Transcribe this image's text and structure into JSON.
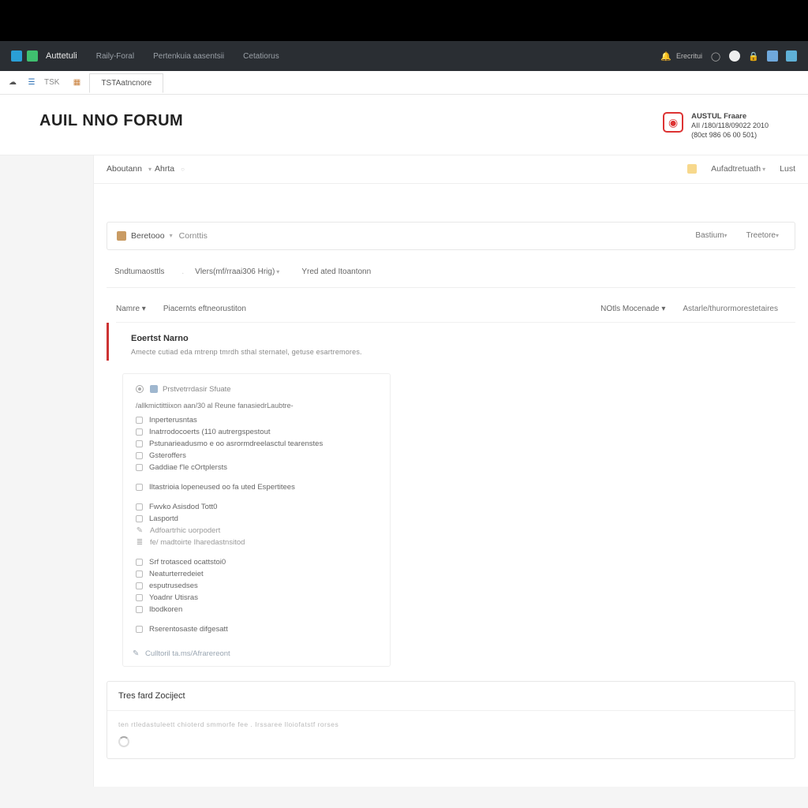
{
  "topnav": {
    "brand": "Auttetuli",
    "links": [
      "Raily-Foral",
      "Pertenkuia aasentsii",
      "Cetatiorus"
    ],
    "status": "Erecritui"
  },
  "subbar": {
    "items": [
      "TSK",
      "TSTAatncnore"
    ]
  },
  "header": {
    "title": "AUIL NNO FORUM",
    "org": {
      "name": "AUSTUL Fraare",
      "line1": "AII /180/118/09022 2010",
      "line2": "(80ct 986 06 00 501)"
    }
  },
  "crumb": {
    "items": [
      "Aboutann",
      "Ahrta"
    ],
    "user": "Aufadtretuath",
    "last": "Lust"
  },
  "bar1": {
    "left": [
      "Beretooo",
      "Cornttis"
    ],
    "right": [
      "Bastium",
      "Treetore"
    ]
  },
  "tabs": {
    "items": [
      "Sndtumaosttls",
      "Vlers(mf/rraai306 Hrig)",
      "Yred ated Itoantonn"
    ]
  },
  "colheads": {
    "left": [
      "Namre",
      "Piacernts eftneorustiton"
    ],
    "right": [
      "NOtls Mocenade",
      "Astarle/thurormorestetaires"
    ]
  },
  "section": {
    "title": "Eoertst Narno",
    "desc": "Amecte cutiad eda mtrenp tmrdh sthal sternatel,  getuse esartremores."
  },
  "panel": {
    "head": "Prstvetrrdasir Sfuate",
    "intro": "/allkmictittiixon aan/30 al Reune fanasiedrLaubtre-",
    "group1": [
      "Inperterusntas",
      "Inatrrodocoerts (110 autrergspestout",
      "Pstunarieadusmo e oo asrormdreelasctul tearenstes",
      "Gsteroffers",
      "Gaddiae f'le cOrtplersts"
    ],
    "item_gap": "Iltastrioia lopeneused oo fa uted Espertitees",
    "group2": [
      "Fwvko Asisdod Tott0",
      "Lasportd"
    ],
    "sub1": "Adfoartrhic uorpodert",
    "sub2": "fe/ madtoirte Iharedastnsitod",
    "group3": [
      "Srf trotasced ocattstoi0",
      "Neaturterredeiet",
      "esputrusedses",
      "Yoadnr Utisras",
      "Ibodkoren",
      "Rserentosaste difgesatt"
    ],
    "foot": "Culltoril ta.ms/Afrarereont"
  },
  "lower": {
    "title": "Tres fard Zociject",
    "note": "ten rtledastuleett chioterd smmorfe   fee . Irssaree lloiofatstf rorses"
  }
}
